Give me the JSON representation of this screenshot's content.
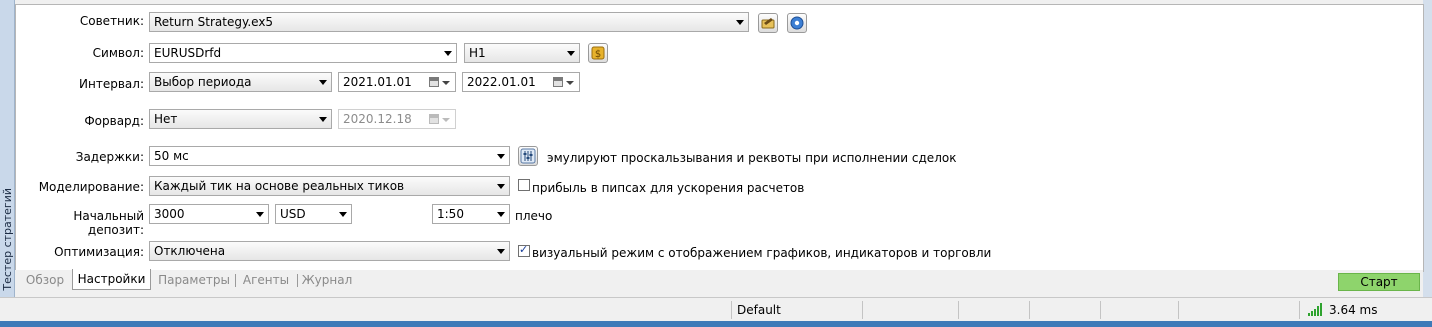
{
  "side_panel_title": "Тестер стратегий",
  "form": {
    "expert_label": "Советник:",
    "expert_value": "Return Strategy.ex5",
    "symbol_label": "Символ:",
    "symbol_value": "EURUSDrfd",
    "timeframe_value": "H1",
    "interval_label": "Интервал:",
    "interval_value": "Выбор периода",
    "date_from": "2021.01.01",
    "date_to": "2022.01.01",
    "forward_label": "Форвард:",
    "forward_value": "Нет",
    "forward_date": "2020.12.18",
    "delays_label": "Задержки:",
    "delays_value": "50 мс",
    "delays_note": "эмулируют проскальзывания и реквоты при исполнении сделок",
    "modeling_label": "Моделирование:",
    "modeling_value": "Каждый тик на основе реальных тиков",
    "pips_checkbox_label": "прибыль в пипсах для ускорения расчетов",
    "pips_checked": false,
    "deposit_label": "Начальный депозит:",
    "deposit_value": "3000",
    "currency_value": "USD",
    "leverage_value": "1:50",
    "leverage_label": "плечо",
    "optimization_label": "Оптимизация:",
    "optimization_value": "Отключена",
    "visual_checkbox_label": "визуальный режим с отображением графиков, индикаторов и торговли",
    "visual_checked": true
  },
  "tabs": [
    "Обзор",
    "Настройки",
    "Параметры",
    "Агенты",
    "Журнал"
  ],
  "active_tab": "Настройки",
  "start_label": "Старт",
  "statusbar": {
    "profile": "Default",
    "ping": "3.64 ms"
  },
  "colors": {
    "start_button": "#8ed46c",
    "signal_icon": "#2fa32f",
    "settings_icon": "#3c7fd4",
    "coin_icon": "#e7b22c"
  }
}
